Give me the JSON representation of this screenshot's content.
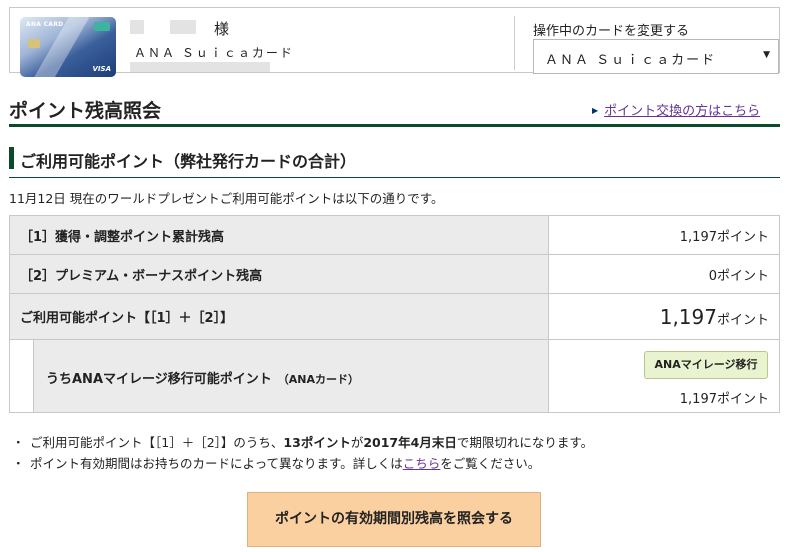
{
  "header": {
    "honorific": "様",
    "card_name": "ＡＮＡ Ｓｕｉｃａカード",
    "card_image": {
      "brand": "ANA CARD",
      "network": "VISA"
    },
    "change_label": "操作中のカードを変更する",
    "selected_card": "ＡＮＡ Ｓｕｉｃａカード"
  },
  "page": {
    "title": "ポイント残高照会",
    "exchange_link": "ポイント交換の方はこちら"
  },
  "section": {
    "title": "ご利用可能ポイント（弊社発行カードの合計）",
    "intro": "11月12日 現在のワールドプレゼントご利用可能ポイントは以下の通りです。"
  },
  "table": {
    "rows": [
      {
        "label": "［1］獲得・調整ポイント累計残高",
        "value": "1,197",
        "unit": "ポイント"
      },
      {
        "label": "［2］プレミアム・ボーナスポイント残高",
        "value": "0",
        "unit": "ポイント"
      },
      {
        "label": "ご利用可能ポイント【［1］＋［2］】",
        "value": "1,197",
        "unit": "ポイント"
      }
    ],
    "sub": {
      "label": "うちANAマイレージ移行可能ポイント",
      "paren": "（ANAカード）",
      "button": "ANAマイレージ移行",
      "value": "1,197ポイント"
    }
  },
  "notes": {
    "note1_a": "ご利用可能ポイント【［1］＋［2］】のうち、",
    "note1_b": "13ポイント",
    "note1_c": "が",
    "note1_d": "2017年4月末日",
    "note1_e": "で期限切れになります。",
    "note2_a": "ポイント有効期間はお持ちのカードによって異なります。詳しくは",
    "note2_link": "こちら",
    "note2_b": "をご覧ください。"
  },
  "footer": {
    "button": "ポイントの有効期間別残高を照会する"
  },
  "colors": {
    "accent_green": "#0c4a2c",
    "link": "#663399",
    "button_orange": "#fbd0a0",
    "mileage_button": "#eaf3cf"
  }
}
